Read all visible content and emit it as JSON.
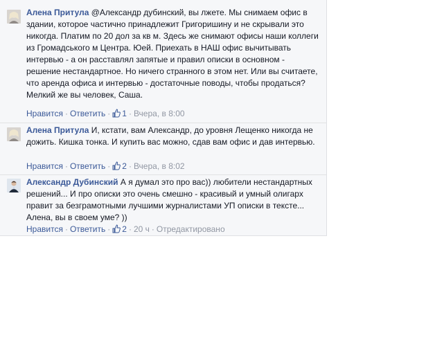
{
  "comments": [
    {
      "author": "Алена Притула",
      "text": "@Александр дубинский, вы лжете. Мы снимаем офис в здании, которое частично принадлежит Григоришину и не скрывали это никогда. Платим по 20 дол за кв м. Здесь же снимают офисы наши коллеги из Громадського м Центра. Юей. Приехать в НАШ офис вычитывать интервью - а он расставлял запятые и правил описки в основном - решение нестандартное. Но ничего странного в этом нет. Или вы считаете, что аренда офиса и интервью - достаточные поводы, чтобы продаться? Мелкий же вы человек, Саша.",
      "like_label": "Нравится",
      "reply_label": "Ответить",
      "likes": "1",
      "time": "Вчера, в 8:00",
      "edited": ""
    },
    {
      "author": "Алена Притула",
      "text": "И, кстати, вам Александр, до уровня Лещенко никогда не дожить. Кишка тонка. И купить вас можно, сдав вам офис и дав интервью.",
      "like_label": "Нравится",
      "reply_label": "Ответить",
      "likes": "2",
      "time": "Вчера, в 8:02",
      "edited": ""
    },
    {
      "author": "Александр Дубинский",
      "text": "А я думал это про вас)) любители нестандартных решений... И про описки это очень смешно - красивый и умный олигарх правит за безграмотными лучшими журналистами УП описки в тексте... Алена, вы в своем уме? ))",
      "like_label": "Нравится",
      "reply_label": "Ответить",
      "likes": "2",
      "time": "20 ч",
      "edited": "Отредактировано"
    }
  ],
  "colors": {
    "link": "#3b5998",
    "meta": "#9197a3",
    "text": "#141823",
    "panel": "#f6f7f9"
  },
  "icons": {
    "like": "thumbs-up-icon"
  }
}
